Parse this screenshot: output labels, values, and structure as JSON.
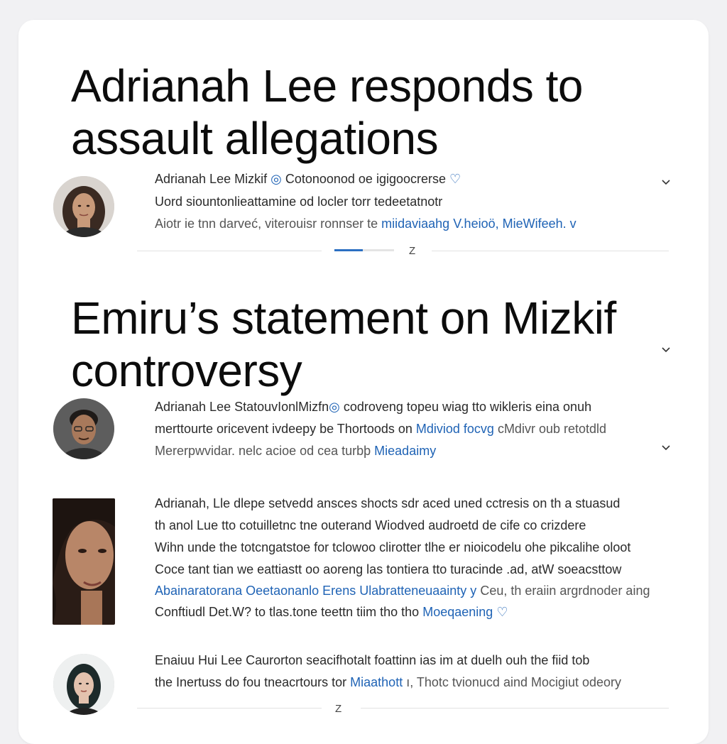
{
  "accent_color": "#1f63b5",
  "sections": [
    {
      "title": "Adrianah Lee responds to assault allegations",
      "post": {
        "line1_text": "Adrianah Lee Mizkif",
        "line1_after": " Cotonoonod oe igigoocrerse",
        "line2": "Uord siountonlieattamine od locler torr tedeetatnotr",
        "line3_text": "Aiotr ie tnn darveć, viterouisr ronnser te ",
        "line3_link": "miidaviaahg V.heioö, MieWifeeh.",
        "line3_tail": "v"
      },
      "pager_label": "Z"
    },
    {
      "title": "Emiru’s statement on Mizkif controversy",
      "posts": [
        {
          "line1_text": "Adrianah Lee StatouvIonlMizfn",
          "line1_after": " codroveng topeu wiag tto wikleris eina onuh",
          "line2_text": "merttourte oricevent ivdeepy  be  Thortoods on ",
          "line2_link": "Mdiviod focvg",
          "line2_tail": " cMdivr oub retotdld",
          "line3_text": "Mererpwvidar.  nelc acioe od cea turbþ ",
          "line3_link": "Mieadaimy"
        },
        {
          "line1": "Adrianah, Lle dlepe setvedd ansces shocts sdr aced uned cctresis on th a stuasud",
          "line2": "th anol Lue tto cotuilletnc tne outerand Wiodved audroetd de cife co crizdere",
          "line3": "Wihn unde the totcngatstoe for  tclowoo clirotter tlhe  er nioicodelu ohe pikcalihe oloot",
          "line4": "Coce tant tian we eattiastt oo aoreng las tontiera tto turacinde .ad,  atW  soeacsttow",
          "line5_link": "Abainaratorana Oeetaonanlo Erens Ulabratteneuaainty y",
          "line5_tail": " Ceu,  th eraiin argrdnoder aing",
          "line6_text": "Conftiudl Det.W? to tlas.tone teettn tiim tho tho ",
          "line6_link": "Moeqaening"
        },
        {
          "line1": "Enaiuu Hui Lee Caurorton seacifhotalt foattinn ias im at duelh ouh the fiid tob",
          "line2_text": "the Inertuss do fou tneacrtours tor ",
          "line2_link": "Miaathott",
          "line2_tail": " ı, Thotc tvionucd aind Mocigiut odeory"
        }
      ],
      "pager_label": "Z"
    }
  ],
  "progress_fraction": 0.48
}
